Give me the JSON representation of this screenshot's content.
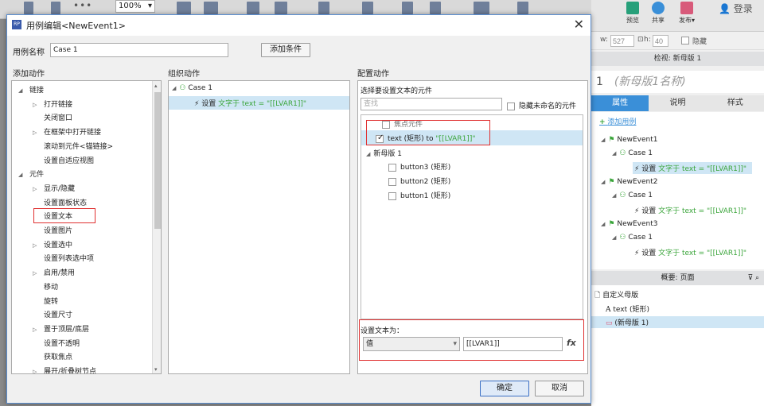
{
  "toolbar": {
    "zoom": "100%"
  },
  "right_panel": {
    "buttons": [
      "预览",
      "共享",
      "发布▾"
    ],
    "login": "登录",
    "w_label": "w:",
    "w_value": "527",
    "h_label": "h:",
    "h_value": "40",
    "hide_label": "隐藏",
    "inspect_title": "检视: 新母版 1",
    "page_title": "(新母版1名称)",
    "page_num": "1",
    "tabs": [
      "属性",
      "说明",
      "样式"
    ],
    "add_case": "添加用例",
    "events": [
      {
        "event": "NewEvent1",
        "case": "Case 1",
        "action_prefix": "设置 ",
        "action": "文字于 text = \"[[LVAR1]]\""
      },
      {
        "event": "NewEvent2",
        "case": "Case 1",
        "action_prefix": "设置 ",
        "action": "文字于 text = \"[[LVAR1]]\""
      },
      {
        "event": "NewEvent3",
        "case": "Case 1",
        "action_prefix": "设置 ",
        "action": "文字于 text = \"[[LVAR1]]\""
      }
    ],
    "outline_title": "概要: 页面",
    "outline_items": [
      "自定义母版",
      "text (矩形)",
      "(新母版 1)"
    ]
  },
  "dialog": {
    "title": "用例编辑<NewEvent1>",
    "case_name_label": "用例名称",
    "case_name": "Case 1",
    "add_condition": "添加条件",
    "col1_title": "添加动作",
    "col2_title": "组织动作",
    "col3_title": "配置动作",
    "actions": [
      {
        "label": "链接",
        "level": 0,
        "arrow": "◢"
      },
      {
        "label": "打开链接",
        "level": 1,
        "arrow": "▷"
      },
      {
        "label": "关闭窗口",
        "level": 1,
        "arrow": ""
      },
      {
        "label": "在框架中打开链接",
        "level": 1,
        "arrow": "▷"
      },
      {
        "label": "滚动到元件<锚链接>",
        "level": 1,
        "arrow": ""
      },
      {
        "label": "设置自适应视图",
        "level": 1,
        "arrow": ""
      },
      {
        "label": "元件",
        "level": 0,
        "arrow": "◢"
      },
      {
        "label": "显示/隐藏",
        "level": 1,
        "arrow": "▷"
      },
      {
        "label": "设置面板状态",
        "level": 1,
        "arrow": ""
      },
      {
        "label": "设置文本",
        "level": 1,
        "arrow": ""
      },
      {
        "label": "设置图片",
        "level": 1,
        "arrow": ""
      },
      {
        "label": "设置选中",
        "level": 1,
        "arrow": "▷"
      },
      {
        "label": "设置列表选中项",
        "level": 1,
        "arrow": ""
      },
      {
        "label": "启用/禁用",
        "level": 1,
        "arrow": "▷"
      },
      {
        "label": "移动",
        "level": 1,
        "arrow": ""
      },
      {
        "label": "旋转",
        "level": 1,
        "arrow": ""
      },
      {
        "label": "设置尺寸",
        "level": 1,
        "arrow": ""
      },
      {
        "label": "置于顶层/底层",
        "level": 1,
        "arrow": "▷"
      },
      {
        "label": "设置不透明",
        "level": 1,
        "arrow": ""
      },
      {
        "label": "获取焦点",
        "level": 1,
        "arrow": ""
      },
      {
        "label": "展开/折叠树节点",
        "level": 1,
        "arrow": "▷"
      }
    ],
    "organize": {
      "case": "Case 1",
      "action_prefix": "设置 ",
      "action": "文字于 text = \"[[LVAR1]]\""
    },
    "config": {
      "select_label": "选择要设置文本的元件",
      "search_placeholder": "查找",
      "hide_unnamed": "隐藏未命名的元件",
      "items": [
        {
          "label": "焦点元件",
          "checked": false
        },
        {
          "label": "text (矩形) to ",
          "value": "\"[[LVAR1]]\"",
          "checked": true
        },
        {
          "label": "新母版 1",
          "group": true
        },
        {
          "label": "button3 (矩形)",
          "checked": false
        },
        {
          "label": "button2 (矩形)",
          "checked": false
        },
        {
          "label": "button1 (矩形)",
          "checked": false
        }
      ],
      "set_text_label": "设置文本为：",
      "type_value": "值",
      "text_value": "[[LVAR1]]",
      "fx": "fx"
    },
    "ok": "确定",
    "cancel": "取消"
  }
}
